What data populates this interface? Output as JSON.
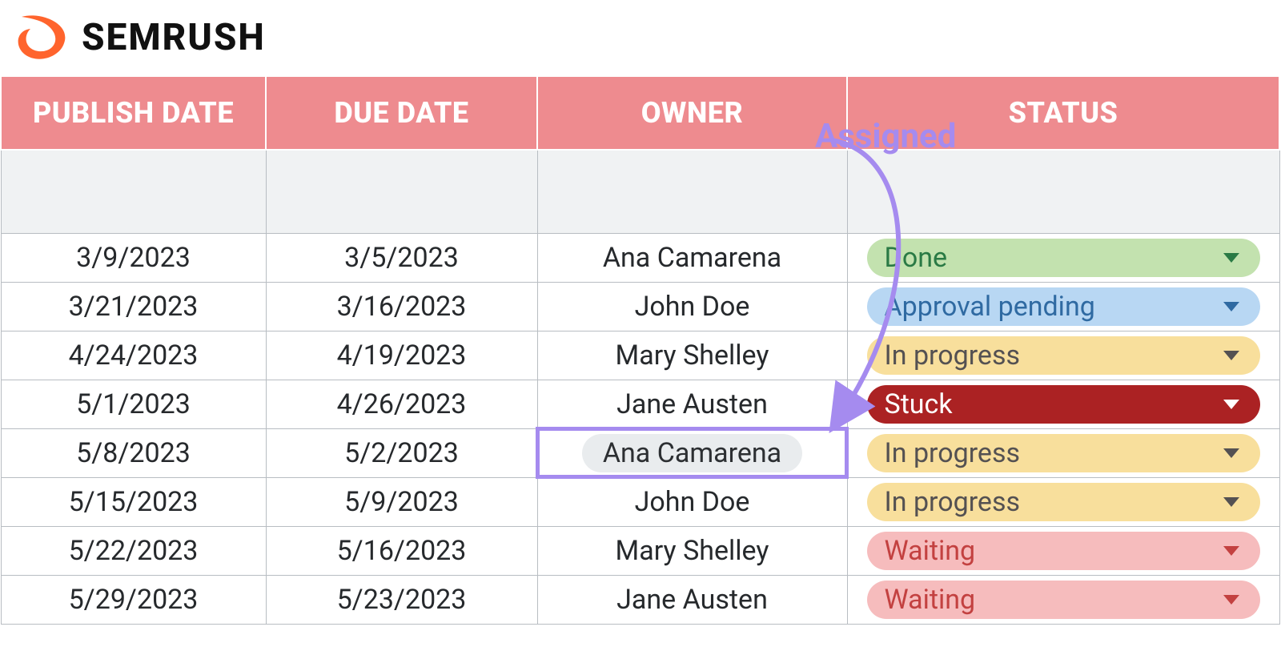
{
  "brand": {
    "name": "SEMRUSH"
  },
  "table": {
    "columns": [
      "PUBLISH DATE",
      "DUE DATE",
      "OWNER",
      "STATUS"
    ],
    "rows": [
      {
        "publish": "3/9/2023",
        "due": "3/5/2023",
        "owner": "Ana Camarena",
        "status": {
          "label": "Done",
          "class": "s-done"
        },
        "highlight_owner": false
      },
      {
        "publish": "3/21/2023",
        "due": "3/16/2023",
        "owner": "John Doe",
        "status": {
          "label": "Approval pending",
          "class": "s-approval"
        },
        "highlight_owner": false
      },
      {
        "publish": "4/24/2023",
        "due": "4/19/2023",
        "owner": "Mary Shelley",
        "status": {
          "label": "In progress",
          "class": "s-inprogress"
        },
        "highlight_owner": false
      },
      {
        "publish": "5/1/2023",
        "due": "4/26/2023",
        "owner": "Jane Austen",
        "status": {
          "label": "Stuck",
          "class": "s-stuck"
        },
        "highlight_owner": false
      },
      {
        "publish": "5/8/2023",
        "due": "5/2/2023",
        "owner": "Ana Camarena",
        "status": {
          "label": "In progress",
          "class": "s-inprogress"
        },
        "highlight_owner": true
      },
      {
        "publish": "5/15/2023",
        "due": "5/9/2023",
        "owner": "John Doe",
        "status": {
          "label": "In progress",
          "class": "s-inprogress"
        },
        "highlight_owner": false
      },
      {
        "publish": "5/22/2023",
        "due": "5/16/2023",
        "owner": "Mary Shelley",
        "status": {
          "label": "Waiting",
          "class": "s-waiting"
        },
        "highlight_owner": false
      },
      {
        "publish": "5/29/2023",
        "due": "5/23/2023",
        "owner": "Jane Austen",
        "status": {
          "label": "Waiting",
          "class": "s-waiting"
        },
        "highlight_owner": false
      }
    ]
  },
  "annotation": {
    "label": "Assigned"
  },
  "colors": {
    "brand_orange": "#ff642d",
    "header_pink": "#ee8b8f",
    "annotation_purple": "#a58bef"
  }
}
